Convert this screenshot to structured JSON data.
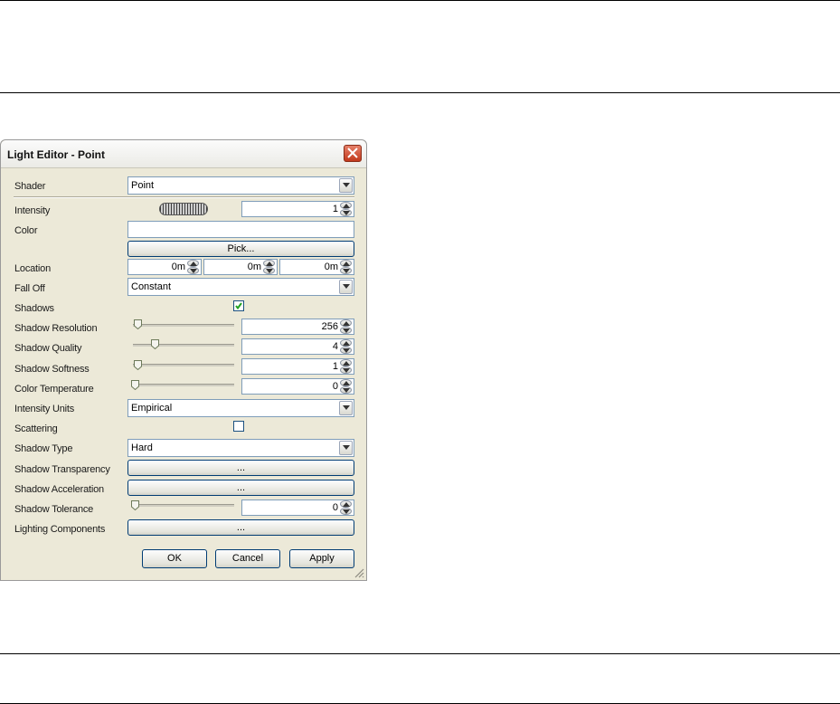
{
  "dialog": {
    "title": "Light Editor - Point",
    "fields": {
      "shader": {
        "label": "Shader",
        "value": "Point"
      },
      "intensity": {
        "label": "Intensity",
        "value": "1"
      },
      "color": {
        "label": "Color",
        "pick_label": "Pick..."
      },
      "location": {
        "label": "Location",
        "x": "0m",
        "y": "0m",
        "z": "0m"
      },
      "fall_off": {
        "label": "Fall Off",
        "value": "Constant"
      },
      "shadows": {
        "label": "Shadows",
        "checked": true
      },
      "shadow_resolution": {
        "label": "Shadow Resolution",
        "value": "256",
        "slider_fraction": 0.03
      },
      "shadow_quality": {
        "label": "Shadow Quality",
        "value": "4",
        "slider_fraction": 0.22
      },
      "shadow_softness": {
        "label": "Shadow Softness",
        "value": "1",
        "slider_fraction": 0.03
      },
      "color_temperature": {
        "label": "Color Temperature",
        "value": "0",
        "slider_fraction": 0.0
      },
      "intensity_units": {
        "label": "Intensity Units",
        "value": "Empirical"
      },
      "scattering": {
        "label": "Scattering",
        "checked": false
      },
      "shadow_type": {
        "label": "Shadow Type",
        "value": "Hard"
      },
      "shadow_transparency": {
        "label": "Shadow Transparency",
        "button_label": "..."
      },
      "shadow_acceleration": {
        "label": "Shadow Acceleration",
        "button_label": "..."
      },
      "shadow_tolerance": {
        "label": "Shadow Tolerance",
        "value": "0",
        "slider_fraction": 0.0
      },
      "lighting_components": {
        "label": "Lighting Components",
        "button_label": "..."
      }
    },
    "buttons": {
      "ok": "OK",
      "cancel": "Cancel",
      "apply": "Apply"
    }
  },
  "colors": {
    "dialog_bg": "#ece9d8",
    "close_button": "#c2391c",
    "button_border": "#003c74",
    "check_mark": "#21a121"
  }
}
